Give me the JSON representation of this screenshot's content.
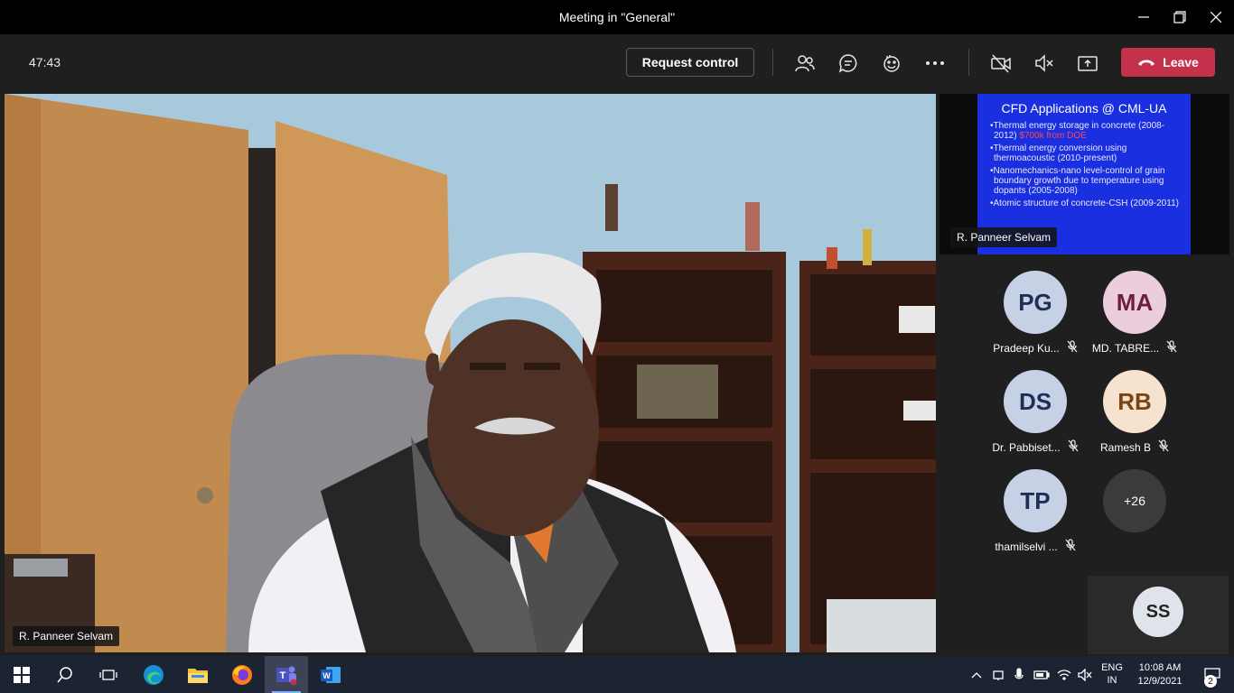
{
  "window": {
    "title": "Meeting in \"General\""
  },
  "toolbar": {
    "timer": "47:43",
    "request_control_label": "Request control",
    "leave_label": "Leave",
    "icons": [
      "participants-icon",
      "chat-icon",
      "reactions-icon",
      "more-icon",
      "camera-off-icon",
      "speaker-muted-icon",
      "share-screen-icon"
    ]
  },
  "main_video": {
    "presenter_name": "R. Panneer Selvam"
  },
  "shared_content": {
    "slide_title": "CFD Applications @ CML-UA",
    "bullets": [
      {
        "text": "•Thermal energy storage in concrete (2008-2012) ",
        "highlight": "$700k from DOE"
      },
      {
        "text": "•Thermal energy conversion using thermoacoustic (2010-present)",
        "highlight": ""
      },
      {
        "text": "•Nanomechanics-nano level-control of grain boundary growth due to temperature using dopants (2005-2008)",
        "highlight": ""
      },
      {
        "text": "•Atomic structure of concrete-CSH (2009-2011)",
        "highlight": ""
      }
    ],
    "presenter_name": "R. Panneer Selvam"
  },
  "participants": [
    {
      "initials": "PG",
      "name": "Pradeep Ku...",
      "muted": true,
      "bg": "#c7d1e6",
      "fg": "#1e2f55"
    },
    {
      "initials": "MA",
      "name": "MD. TABRE...",
      "muted": true,
      "bg": "#eccddc",
      "fg": "#6b1e3e"
    },
    {
      "initials": "DS",
      "name": "Dr. Pabbiset...",
      "muted": true,
      "bg": "#c7d1e6",
      "fg": "#1e2f55"
    },
    {
      "initials": "RB",
      "name": "Ramesh B",
      "muted": true,
      "bg": "#f7e2cf",
      "fg": "#7a4415"
    },
    {
      "initials": "TP",
      "name": "thamilselvi ...",
      "muted": true,
      "bg": "#c7d1e6",
      "fg": "#1e2f55"
    }
  ],
  "overflow": {
    "label": "+26"
  },
  "self_view": {
    "initials": "SS"
  },
  "taskbar": {
    "apps": [
      "windows-start-icon",
      "search-icon",
      "task-view-icon",
      "edge-icon",
      "file-explorer-icon",
      "firefox-icon",
      "teams-icon",
      "word-icon"
    ],
    "lang_top": "ENG",
    "lang_bottom": "IN",
    "time": "10:08 AM",
    "date": "12/9/2021",
    "notifications": "2"
  }
}
